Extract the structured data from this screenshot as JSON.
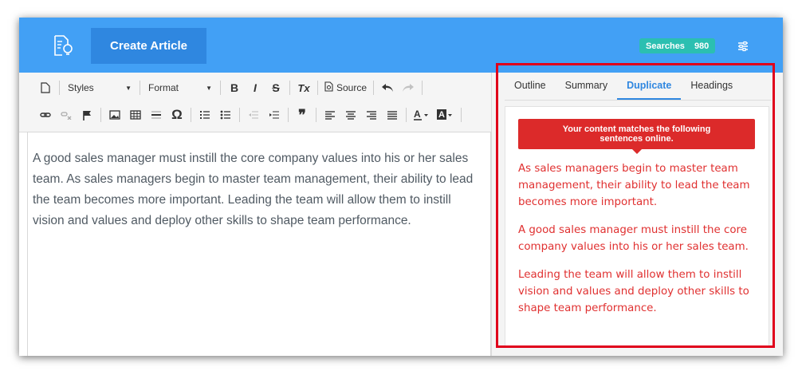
{
  "header": {
    "create_label": "Create Article",
    "searches_label": "Searches",
    "searches_count": "980",
    "logo_icon": "document-bulb-icon",
    "settings_icon": "sliders-icon"
  },
  "toolbar": {
    "styles_label": "Styles",
    "format_label": "Format",
    "source_label": "Source",
    "bold": "B",
    "italic": "I",
    "strike": "S",
    "clear_format": "Tx",
    "omega": "Ω",
    "quote": "❞"
  },
  "editor": {
    "content": "A good sales manager must instill the core company values into his or her sales team. As sales managers begin to master team management, their ability to lead the team becomes more important. Leading the team will allow them to instill vision and values and deploy other skills to shape team performance."
  },
  "sidebar": {
    "tabs": [
      {
        "label": "Outline"
      },
      {
        "label": "Summary"
      },
      {
        "label": "Duplicate"
      },
      {
        "label": "Headings"
      }
    ],
    "active_tab": "Duplicate",
    "alert_text": "Your content matches the following sentences online.",
    "matches": [
      "As sales managers begin to master team management, their ability to lead the team becomes more important.",
      "A good sales manager must instill the core company values into his or her sales team.",
      "Leading the team will allow them to instill vision and values and deploy other skills to shape team performance."
    ]
  },
  "colors": {
    "topbar": "#42a0f5",
    "create_button": "#2f87e0",
    "searches_badge": "#2bbfb1",
    "alert": "#dc2a2a",
    "match_text": "#e03030",
    "highlight_border": "#e0001b"
  }
}
